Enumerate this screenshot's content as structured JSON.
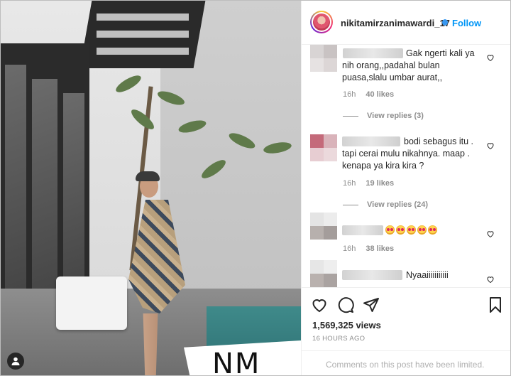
{
  "post": {
    "username": "nikitamirzanimawardi_17",
    "follow_label": "Follow",
    "watermark": "NM"
  },
  "comments": [
    {
      "text": "Gak ngerti kali ya nih orang,,padahal bulan puasa,slalu umbar aurat,,",
      "time": "16h",
      "likes": "40 likes",
      "view_replies": "View replies (3)"
    },
    {
      "text": "bodi sebagus itu . tapi cerai mulu nikahnya. maap . kenapa ya kira kira ?",
      "time": "16h",
      "likes": "19 likes",
      "view_replies": "View replies (24)"
    },
    {
      "text": "",
      "emoji_count": 5,
      "time": "16h",
      "likes": "38 likes"
    },
    {
      "text": "Nyaaiiiiiiiiiii"
    }
  ],
  "footer": {
    "views": "1,569,325 views",
    "age": "16 HOURS AGO",
    "limited_text": "Comments on this post have been limited."
  },
  "colors": {
    "link": "#0095f6",
    "muted": "#8e8e8e",
    "text": "#262626"
  },
  "icons": [
    "heart-icon",
    "comment-icon",
    "share-icon",
    "bookmark-icon",
    "user-tag-icon"
  ]
}
